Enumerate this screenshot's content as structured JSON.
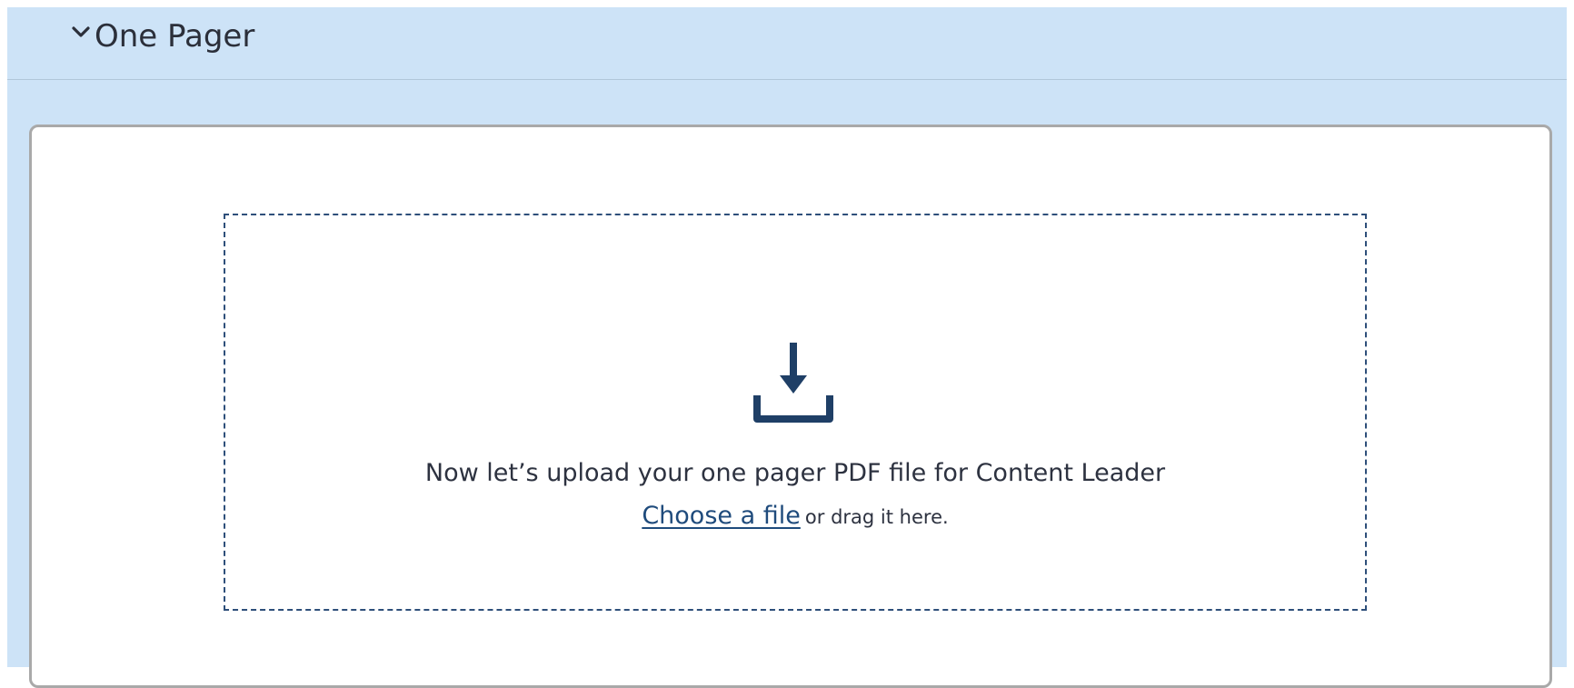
{
  "section": {
    "title": "One Pager",
    "toggle_icon": "chevron-down-icon"
  },
  "upload": {
    "icon": "download-tray-icon",
    "prompt": "Now let’s upload your one pager PDF file for Content Leader",
    "choose_link": "Choose a file",
    "drag_text": "or drag it here."
  },
  "colors": {
    "panel_bg": "#cde3f7",
    "card_border": "#a9a9a9",
    "accent": "#1f4b7c",
    "dropzone_border": "#2e4f7a"
  }
}
